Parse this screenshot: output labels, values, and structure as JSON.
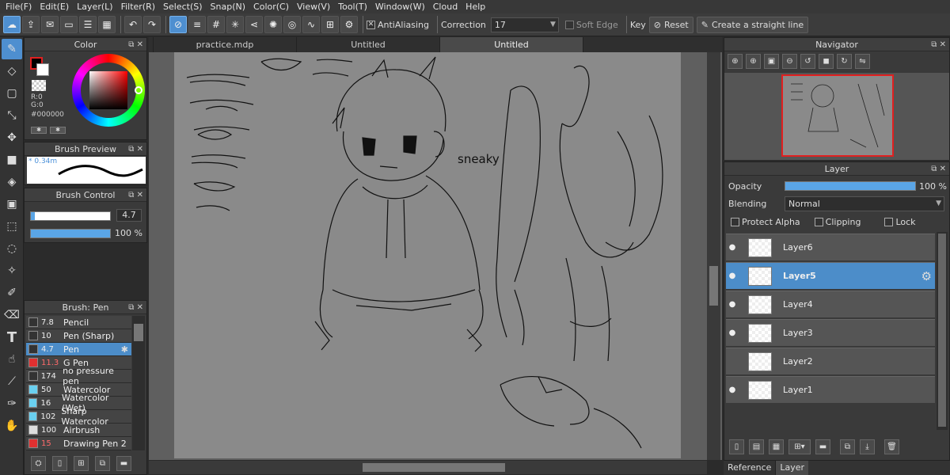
{
  "menu": [
    "File(F)",
    "Edit(E)",
    "Layer(L)",
    "Filter(R)",
    "Select(S)",
    "Snap(N)",
    "Color(C)",
    "View(V)",
    "Tool(T)",
    "Window(W)",
    "Cloud",
    "Help"
  ],
  "toolbar": {
    "antialiasing_label": "AntiAliasing",
    "correction_label": "Correction",
    "correction_value": "17",
    "soft_edge_label": "Soft Edge",
    "key_label": "Key",
    "reset_label": "Reset",
    "straight_line_label": "Create a straight line"
  },
  "color_panel": {
    "title": "Color",
    "r": "R:0",
    "g": "G:0",
    "hex": "#000000",
    "fg": "#000000",
    "bg": "#ffffff"
  },
  "brush_preview": {
    "title": "Brush Preview",
    "size_text": "* 0.34m"
  },
  "brush_control": {
    "title": "Brush Control",
    "size": "4.7",
    "size_fraction": 0.05,
    "opacity": "100 %",
    "opacity_fraction": 1.0
  },
  "brush_list": {
    "title": "Brush: Pen",
    "items": [
      {
        "size": "7.8",
        "name": "Pencil",
        "color": "#333333"
      },
      {
        "size": "10",
        "name": "Pen (Sharp)",
        "color": "#333333"
      },
      {
        "size": "4.7",
        "name": "Pen",
        "color": "#333333",
        "selected": true
      },
      {
        "size": "11.3",
        "name": "G Pen",
        "color": "#e03030"
      },
      {
        "size": "174",
        "name": "no pressure pen",
        "color": "#333333"
      },
      {
        "size": "50",
        "name": "Watercolor",
        "color": "#6ad0f0"
      },
      {
        "size": "16",
        "name": "Watercolor (Wet)",
        "color": "#6ad0f0"
      },
      {
        "size": "102",
        "name": "Sharp Watercolor",
        "color": "#6ad0f0"
      },
      {
        "size": "100",
        "name": "Airbrush",
        "color": "#dddddd"
      },
      {
        "size": "15",
        "name": "Drawing Pen 2",
        "color": "#e03030"
      }
    ]
  },
  "tabs": [
    "practice.mdp",
    "Untitled",
    "Untitled"
  ],
  "navigator": {
    "title": "Navigator"
  },
  "layer_panel": {
    "title": "Layer",
    "opacity_label": "Opacity",
    "opacity_value": "100 %",
    "opacity_fraction": 1.0,
    "blending_label": "Blending",
    "blending_value": "Normal",
    "protect_alpha": "Protect Alpha",
    "clipping": "Clipping",
    "lock": "Lock",
    "layers": [
      {
        "name": "Layer6",
        "visible": true
      },
      {
        "name": "Layer5",
        "visible": true,
        "selected": true
      },
      {
        "name": "Layer4",
        "visible": true
      },
      {
        "name": "Layer3",
        "visible": true
      },
      {
        "name": "Layer2",
        "visible": false
      },
      {
        "name": "Layer1",
        "visible": true
      }
    ]
  },
  "bottom_tabs": [
    "Reference",
    "Layer"
  ],
  "sketch_text": "sneaky"
}
